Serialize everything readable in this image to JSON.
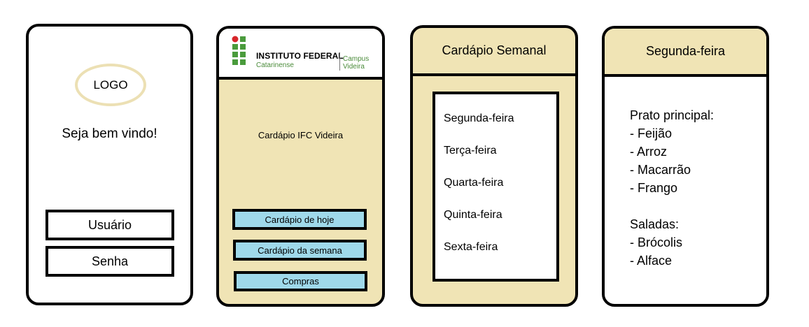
{
  "login": {
    "logo_text": "LOGO",
    "welcome": "Seja bem vindo!",
    "user_label": "Usuário",
    "password_label": "Senha"
  },
  "home": {
    "institution_name": "INSTITUTO FEDERAL",
    "institution_sub": "Catarinense",
    "campus_line1": "Campus",
    "campus_line2": "Videira",
    "app_title": "Cardápio IFC Videira",
    "buttons": [
      "Cardápio de hoje",
      "Cardápio da semana",
      "Compras"
    ],
    "colors": {
      "logo_green": "#4a9b3c",
      "logo_red": "#d7252a",
      "button_blue": "#9fd9ea",
      "panel_beige": "#f0e4b5"
    }
  },
  "weekly": {
    "title": "Cardápio Semanal",
    "days": [
      "Segunda-feira",
      "Terça-feira",
      "Quarta-feira",
      "Quinta-feira",
      "Sexta-feira"
    ]
  },
  "day_detail": {
    "title": "Segunda-feira",
    "main_heading": "Prato principal:",
    "main_items": [
      "- Feijão",
      "- Arroz",
      "- Macarrão",
      "- Frango"
    ],
    "salad_heading": "Saladas:",
    "salad_items": [
      "- Brócolis",
      "- Alface"
    ]
  }
}
